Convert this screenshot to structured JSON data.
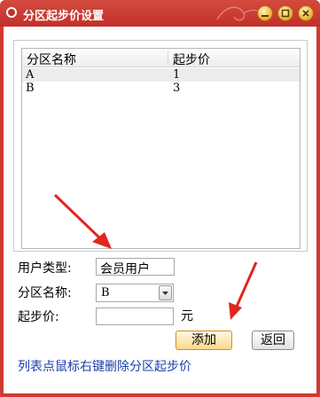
{
  "window": {
    "title": "分区起步价设置"
  },
  "list": {
    "columns": [
      "分区名称",
      "起步价"
    ],
    "rows": [
      {
        "name": "A",
        "price": "1"
      },
      {
        "name": "B",
        "price": "3"
      }
    ]
  },
  "form": {
    "user_type_label": "用户类型:",
    "user_type_value": "会员用户",
    "zone_label": "分区名称:",
    "zone_value": "B",
    "price_label": "起步价:",
    "price_value": "",
    "unit": "元"
  },
  "buttons": {
    "add": "添加",
    "back": "返回"
  },
  "hint": "列表点鼠标右键删除分区起步价",
  "colors": {
    "titlebar": "#c2302a",
    "annotation_arrow": "#e0261f",
    "hint": "#1a3ea8"
  }
}
